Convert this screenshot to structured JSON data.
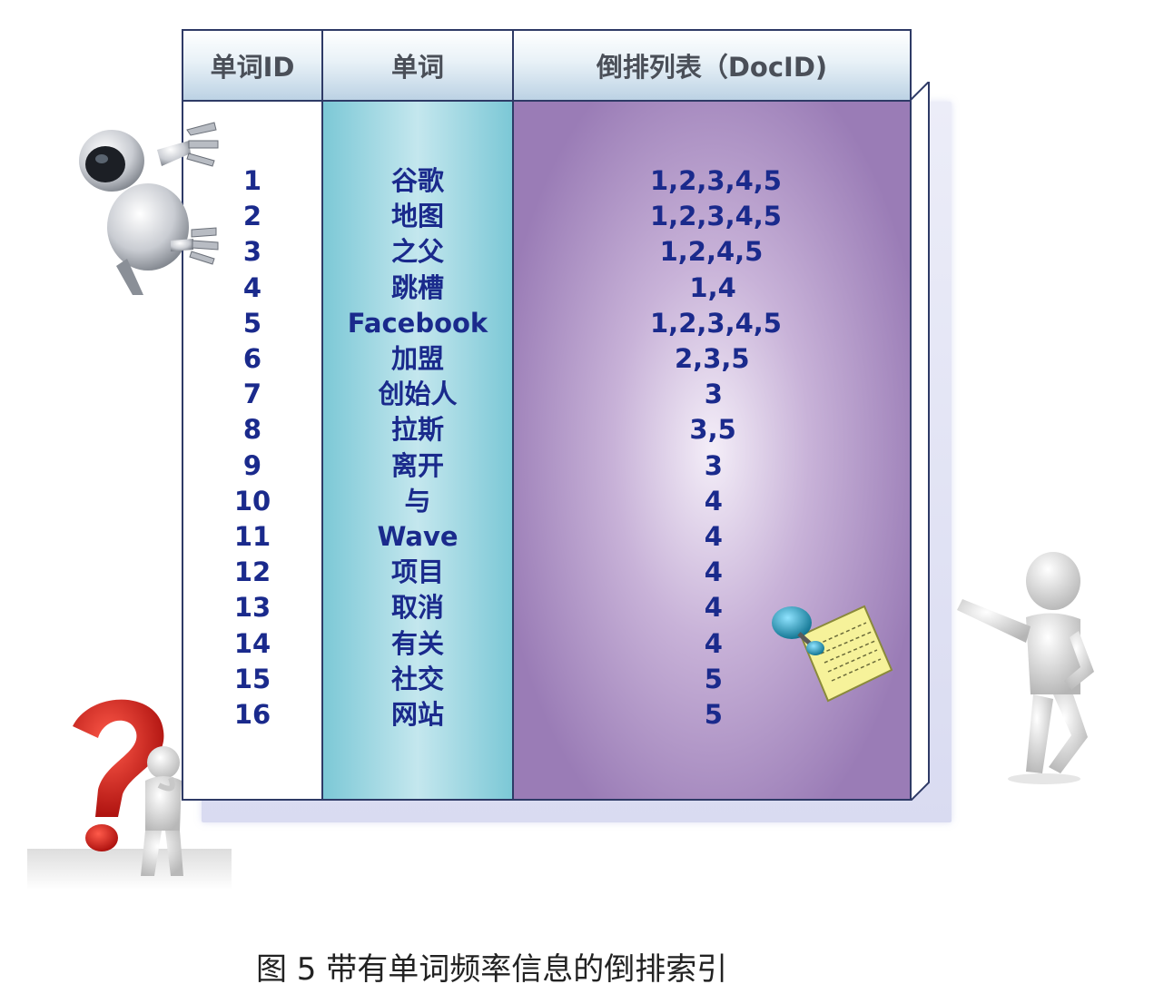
{
  "table": {
    "headers": [
      "单词ID",
      "单词",
      "倒排列表（DocID)"
    ],
    "rows": [
      {
        "id": "1",
        "word": "谷歌",
        "docs": "1,2,3,4,5"
      },
      {
        "id": "2",
        "word": "地图",
        "docs": "1,2,3,4,5"
      },
      {
        "id": "3",
        "word": "之父",
        "docs": "1,2,4,5"
      },
      {
        "id": "4",
        "word": "跳槽",
        "docs": "1,4"
      },
      {
        "id": "5",
        "word": "Facebook",
        "docs": "1,2,3,4,5"
      },
      {
        "id": "6",
        "word": "加盟",
        "docs": "2,3,5"
      },
      {
        "id": "7",
        "word": "创始人",
        "docs": "3"
      },
      {
        "id": "8",
        "word": "拉斯",
        "docs": "3,5"
      },
      {
        "id": "9",
        "word": "离开",
        "docs": "3"
      },
      {
        "id": "10",
        "word": "与",
        "docs": "4"
      },
      {
        "id": "11",
        "word": "Wave",
        "docs": "4"
      },
      {
        "id": "12",
        "word": "项目",
        "docs": "4"
      },
      {
        "id": "13",
        "word": "取消",
        "docs": "4"
      },
      {
        "id": "14",
        "word": "有关",
        "docs": "4"
      },
      {
        "id": "15",
        "word": "社交",
        "docs": "5"
      },
      {
        "id": "16",
        "word": "网站",
        "docs": "5"
      }
    ]
  },
  "caption": "图 5 带有单词频率信息的倒排索引",
  "colors": {
    "row_text": "#1a2a8c",
    "header_text": "#4a4f58",
    "border": "#2e3a66",
    "word_column": "#7cc8d6",
    "doc_column": "#9a7cb6"
  },
  "decorations": [
    "robot-figure",
    "question-mark-figure",
    "leaning-figure",
    "pushpin-note-icon"
  ]
}
